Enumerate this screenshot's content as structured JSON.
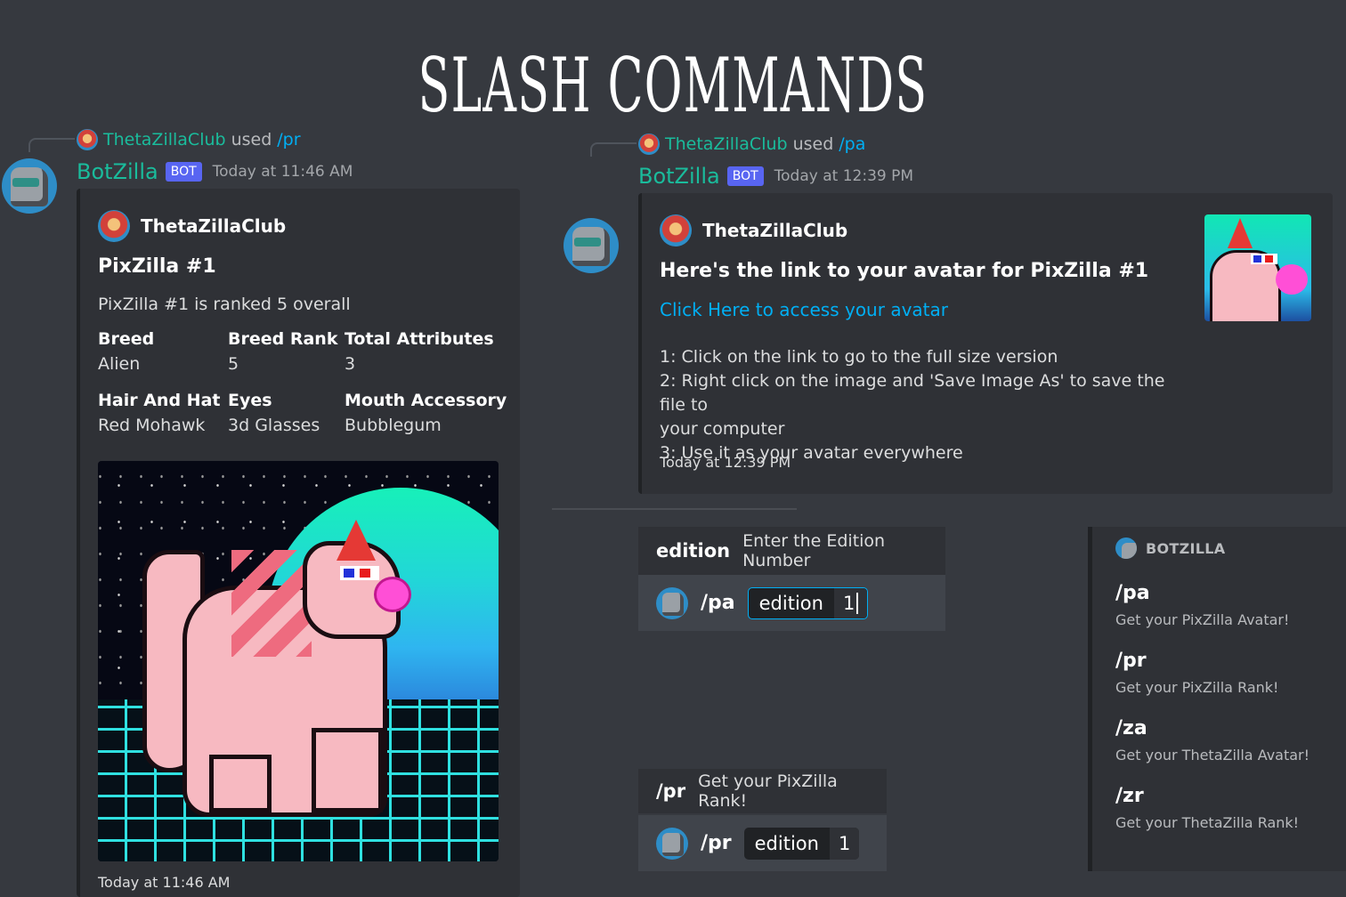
{
  "page_title": "SLASH COMMANDS",
  "left_message": {
    "reply": {
      "user": "ThetaZillaClub",
      "used": "used",
      "command": "/pr"
    },
    "author": "BotZilla",
    "bot_tag": "BOT",
    "timestamp": "Today at 11:46 AM",
    "embed": {
      "author": "ThetaZillaClub",
      "title": "PixZilla #1",
      "description": "PixZilla #1 is ranked 5 overall",
      "fields": [
        {
          "name": "Breed",
          "value": "Alien"
        },
        {
          "name": "Breed Rank",
          "value": "5"
        },
        {
          "name": "Total Attributes",
          "value": "3"
        },
        {
          "name": "Hair And Hat",
          "value": "Red Mohawk"
        },
        {
          "name": "Eyes",
          "value": "3d Glasses"
        },
        {
          "name": "Mouth Accessory",
          "value": "Bubblegum"
        }
      ],
      "footer": "Today at 11:46 AM"
    }
  },
  "right_message": {
    "reply": {
      "user": "ThetaZillaClub",
      "used": "used",
      "command": "/pa"
    },
    "author": "BotZilla",
    "bot_tag": "BOT",
    "timestamp": "Today at 12:39 PM",
    "embed": {
      "author": "ThetaZillaClub",
      "title": "Here's the link to your avatar for PixZilla #1",
      "link": "Click Here to access your avatar",
      "steps": [
        "1: Click on the link to go to the full size version",
        "2: Right click on the image and 'Save Image As' to save the file to",
        "your computer",
        "3: Use it as your avatar everywhere"
      ],
      "footer": "Today at 12:39 PM"
    }
  },
  "popup_pa": {
    "option_key": "edition",
    "option_desc": "Enter the Edition Number",
    "command": "/pa",
    "pill_key": "edition",
    "pill_value": "1"
  },
  "popup_pr": {
    "command_key": "/pr",
    "command_desc": "Get your PixZilla Rank!",
    "command": "/pr",
    "pill_key": "edition",
    "pill_value": "1"
  },
  "sidebar": {
    "label": "BOTZILLA",
    "commands": [
      {
        "cmd": "/pa",
        "desc": "Get your PixZilla Avatar!"
      },
      {
        "cmd": "/pr",
        "desc": "Get your PixZilla Rank!"
      },
      {
        "cmd": "/za",
        "desc": "Get your ThetaZilla Avatar!"
      },
      {
        "cmd": "/zr",
        "desc": "Get your ThetaZilla Rank!"
      }
    ]
  },
  "colors": {
    "background": "#36393f",
    "embed": "#2f3136",
    "accent_teal": "#1abc9c",
    "link": "#00aff4",
    "bot_tag": "#5865f2"
  }
}
